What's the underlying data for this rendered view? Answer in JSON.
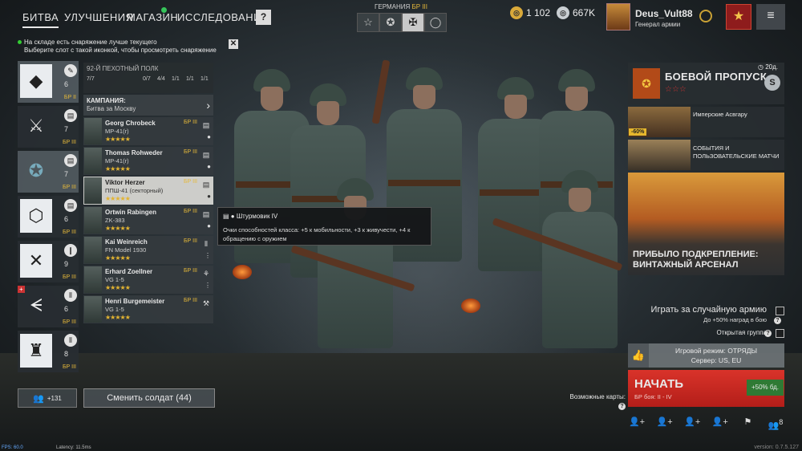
{
  "nav": {
    "battle": "БИТВА",
    "upgrades": "УЛУЧШЕНИЯ",
    "shop": "МАГАЗИН",
    "research": "ИССЛЕДОВАНИЯ",
    "help": "?"
  },
  "nation": {
    "name": "ГЕРМАНИЯ",
    "br": "БР III",
    "tabs": [
      "☆",
      "✪",
      "✠",
      "◯"
    ]
  },
  "currency": {
    "silver": "1 102",
    "gold": "667K"
  },
  "profile": {
    "nickname": "Deus_Vult88",
    "rank": "Генерал армии"
  },
  "notice": {
    "line1": "На складе есть снаряжение лучше текущего",
    "line2": "Выберите слот с такой иконкой, чтобы просмотреть снаряжение",
    "close": "✕"
  },
  "squads": [
    {
      "emblem": "◆",
      "count": "6",
      "br": "БР II"
    },
    {
      "emblem": "⚔",
      "count": "7",
      "br": "БР III"
    },
    {
      "emblem": "✪",
      "count": "7",
      "br": "БР III"
    },
    {
      "emblem": "⬡",
      "count": "6",
      "br": "БР III"
    },
    {
      "emblem": "✕",
      "count": "9",
      "br": "БР III"
    },
    {
      "emblem": "ᗕ",
      "count": "6",
      "br": "БР III"
    },
    {
      "emblem": "♜",
      "count": "8",
      "br": "БР III"
    }
  ],
  "squad_panel": {
    "title": "92-Й ПЕХОТНЫЙ ПОЛК",
    "counts": [
      "7/7",
      "0/7",
      "4/4",
      "1/1",
      "1/1",
      "1/1"
    ],
    "campaign_label": "КАМПАНИЯ:",
    "campaign_value": "Битва за Москву"
  },
  "soldiers": [
    {
      "name": "Georg Chrobeck",
      "weapon": "MP-41(r)",
      "stars": "★★★★★",
      "br": "БР III"
    },
    {
      "name": "Thomas Rohweder",
      "weapon": "MP-41(r)",
      "stars": "★★★★★",
      "br": "БР III"
    },
    {
      "name": "Viktor Herzer",
      "weapon": "ППШ-41 (секторный)",
      "stars": "★★★★★",
      "br": "БР III"
    },
    {
      "name": "Ortwin Rabingen",
      "weapon": "ZK-383",
      "stars": "★★★★★",
      "br": "БР III"
    },
    {
      "name": "Kai Weinreich",
      "weapon": "FN Model 1930",
      "stars": "★★★★★",
      "br": "БР III"
    },
    {
      "name": "Erhard Zoellner",
      "weapon": "VG 1-5",
      "stars": "★★★★★",
      "br": "БР III"
    },
    {
      "name": "Henri Burgemeister",
      "weapon": "VG 1-5",
      "stars": "★★★★★",
      "br": "БР III"
    }
  ],
  "tooltip": {
    "title": "Штурмовик IV",
    "body": "Очки способностей класса: +5 к мобильности, +3 к живучести, +4 к обращению с оружием"
  },
  "reserve": {
    "count": "+131"
  },
  "change_soldier": "Сменить солдат (44)",
  "battle_pass": {
    "title": "БОЕВОЙ ПРОПУСК",
    "stars": "☆☆☆",
    "level": "S",
    "timer": "20д."
  },
  "offers": [
    {
      "text": "Имперские Асвгару",
      "discount": "-60%"
    },
    {
      "text": "СОБЫТИЯ И ПОЛЬЗОВАТЕЛЬСКИЕ МАТЧИ"
    }
  ],
  "banner": {
    "title_line1": "ПРИБЫЛО ПОДКРЕПЛЕНИЕ:",
    "title_line2": "ВИНТАЖНЫЙ АРСЕНАЛ"
  },
  "random_army": {
    "label": "Играть за случайную армию",
    "sub": "До +50% наград в бою"
  },
  "open_group": {
    "label": "Открытая группа"
  },
  "mode": {
    "line1": "Игровой режим: ОТРЯДЫ",
    "line2": "Сервер: US, EU"
  },
  "start": {
    "label": "НАЧАТЬ",
    "sub": "БР боя: II - IV",
    "xp": "+50% бд."
  },
  "maps": {
    "label": "Возможные карты:"
  },
  "toolbar": {
    "group_count": "8"
  },
  "debug": {
    "fps": "FPS: 60.0",
    "latency": "Latency: 11.5ms",
    "version": "version: 0.7.5.127"
  }
}
